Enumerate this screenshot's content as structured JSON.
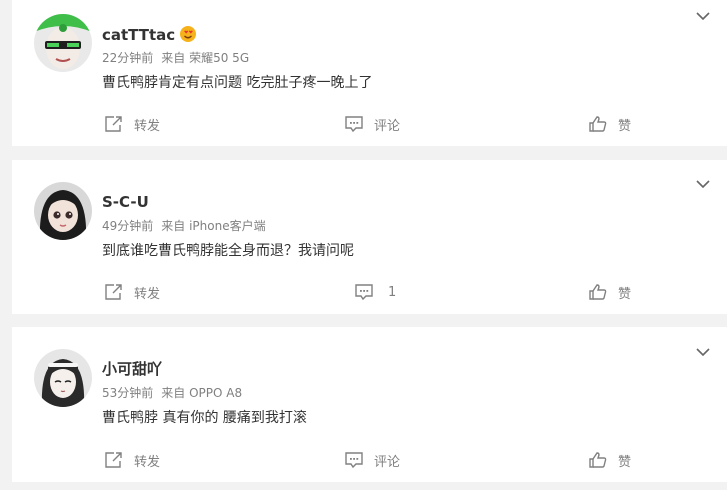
{
  "comments": [
    {
      "username": "catTTtac",
      "time": "22分钟前",
      "source": "来自 荣耀50 5G",
      "content": "曹氏鸭脖肯定有点问题 吃完肚子疼一晚上了",
      "forward_label": "转发",
      "comment_label": "评论",
      "like_label": "赞",
      "avatar_icon": "avatar-green-sunglasses",
      "badge_icon": "heart-eyes-emoji-icon"
    },
    {
      "username": "S-C-U",
      "time": "49分钟前",
      "source": "来自 iPhone客户端",
      "content": "到底谁吃曹氏鸭脖能全身而退？我请问呢",
      "forward_label": "转发",
      "comment_label": "1",
      "like_label": "赞",
      "avatar_icon": "avatar-doll-face"
    },
    {
      "username": "小可甜吖",
      "time": "53分钟前",
      "source": "来自 OPPO A8",
      "content": "曹氏鸭脖 真有你的 腰痛到我打滚",
      "forward_label": "转发",
      "comment_label": "评论",
      "like_label": "赞",
      "avatar_icon": "avatar-anime-girl"
    }
  ],
  "colors": {
    "background": "#f2f2f2",
    "card": "#ffffff",
    "text_primary": "#333333",
    "text_secondary": "#808080"
  }
}
